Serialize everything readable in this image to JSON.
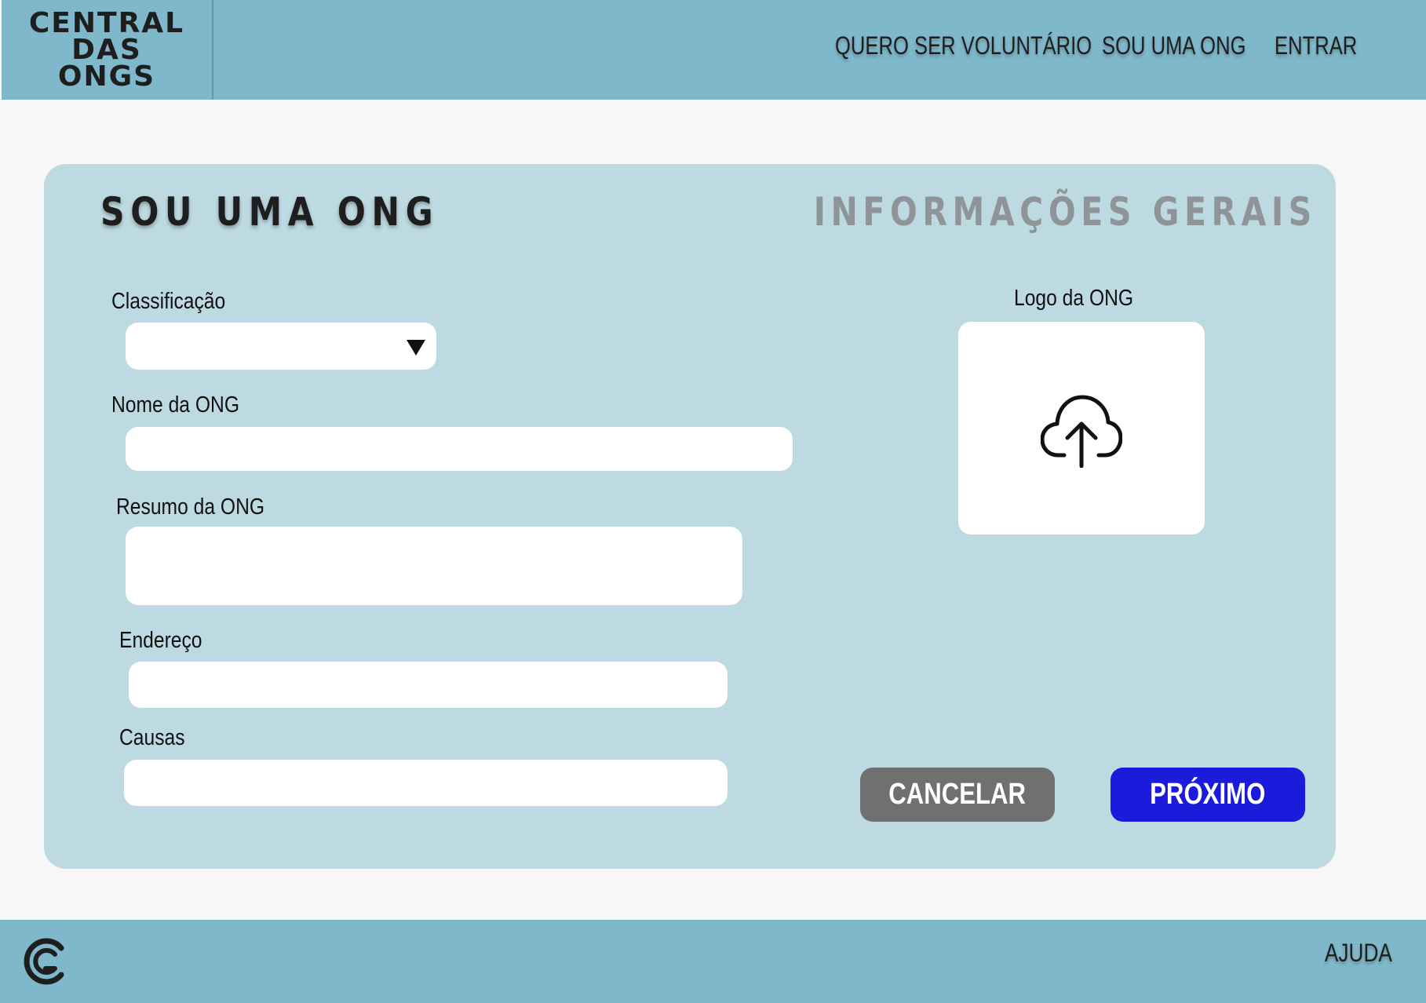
{
  "brand": {
    "lines": [
      "CENTRAL",
      "DAS",
      "ONGS"
    ]
  },
  "nav": {
    "items": [
      {
        "label": "QUERO SER VOLUNTÁRIO"
      },
      {
        "label": "SOU UMA ONG"
      },
      {
        "label": "ENTRAR"
      }
    ]
  },
  "form": {
    "title": "SOU UMA ONG",
    "step": "INFORMAÇÕES GERAIS",
    "fields": {
      "classificacao": {
        "label": "Classificação",
        "value": ""
      },
      "nome": {
        "label": "Nome da ONG",
        "value": "",
        "placeholder": ""
      },
      "resumo": {
        "label": "Resumo da ONG",
        "value": "",
        "placeholder": ""
      },
      "endereco": {
        "label": "Endereço",
        "value": "",
        "placeholder": ""
      },
      "causas": {
        "label": "Causas",
        "value": "",
        "placeholder": ""
      }
    },
    "logo_upload": {
      "label": "Logo da ONG",
      "icon": "cloud-upload-icon"
    },
    "buttons": {
      "cancel": "CANCELAR",
      "next": "PRÓXIMO"
    }
  },
  "footer": {
    "logo_icon": "central-das-ongs-c-logo-icon",
    "help": "AJUDA"
  },
  "colors": {
    "header_bg": "#7fb8cb",
    "card_bg": "#bdd9e1",
    "page_bg": "#f7f7f7",
    "cancel_button": "#707070",
    "next_button": "#1d1bdb",
    "step_text": "#8e9497"
  }
}
